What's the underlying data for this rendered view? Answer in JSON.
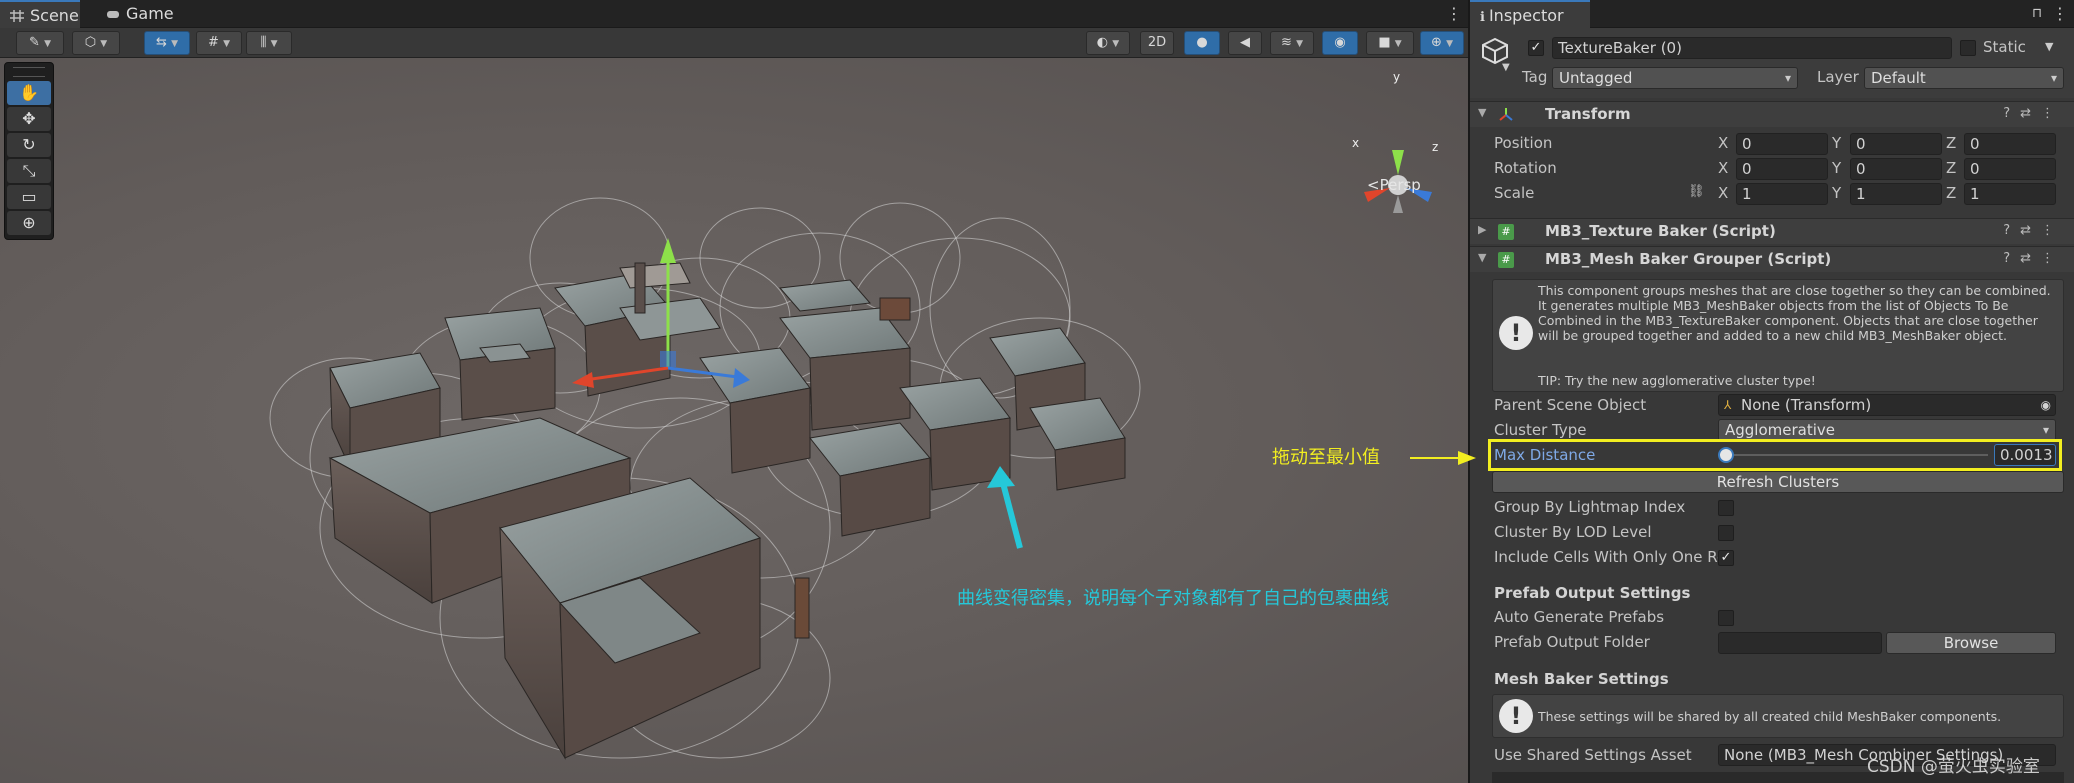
{
  "scene_tabs": [
    {
      "label": "Scene",
      "icon": "grid-icon",
      "active": true
    },
    {
      "label": "Game",
      "icon": "gamepad-icon",
      "active": false
    }
  ],
  "scene_toolbar": {
    "mode_2d_label": "2D"
  },
  "viewport": {
    "persp_label": "Persp",
    "gizmo_axes": {
      "x": "x",
      "y": "y",
      "z": "z"
    }
  },
  "annotations": {
    "curves_note": "曲线变得密集，说明每个子对象都有了自己的包裹曲线",
    "drag_note": "拖动至最小值"
  },
  "inspector": {
    "tab_label": "Inspector",
    "object_name": "TextureBaker (0)",
    "active_checked": true,
    "static_label": "Static",
    "tag_label": "Tag",
    "tag_value": "Untagged",
    "layer_label": "Layer",
    "layer_value": "Default",
    "transform": {
      "title": "Transform",
      "position": {
        "label": "Position",
        "x": "0",
        "y": "0",
        "z": "0"
      },
      "rotation": {
        "label": "Rotation",
        "x": "0",
        "y": "0",
        "z": "0"
      },
      "scale": {
        "label": "Scale",
        "x": "1",
        "y": "1",
        "z": "1"
      },
      "axis_labels": {
        "x": "X",
        "y": "Y",
        "z": "Z"
      }
    },
    "texture_baker": {
      "title": "MB3_Texture Baker (Script)"
    },
    "mesh_baker_grouper": {
      "title": "MB3_Mesh Baker Grouper (Script)",
      "help_text": "This component groups meshes that are close together so they can be combined. It generates multiple MB3_MeshBaker objects from the list of Objects To Be Combined in the MB3_TextureBaker component. Objects that are close together will be grouped together and added to a new child MB3_MeshBaker object.",
      "tip_text": "TIP: Try the new agglomerative cluster type!",
      "parent_scene_object": {
        "label": "Parent Scene Object",
        "value": "None (Transform)"
      },
      "cluster_type": {
        "label": "Cluster Type",
        "value": "Agglomerative"
      },
      "max_distance": {
        "label": "Max Distance",
        "value": "0.0013",
        "slider_fraction": 0.0
      },
      "refresh_button": "Refresh Clusters",
      "group_by_lightmap": {
        "label": "Group By Lightmap Index",
        "checked": false
      },
      "cluster_by_lod": {
        "label": "Cluster By LOD Level",
        "checked": false
      },
      "include_cells": {
        "label": "Include Cells With Only One Re",
        "checked": true
      },
      "prefab_output_title": "Prefab Output Settings",
      "auto_generate_prefabs": {
        "label": "Auto Generate Prefabs",
        "checked": false
      },
      "prefab_output_folder": {
        "label": "Prefab Output Folder",
        "value": ""
      },
      "browse_button": "Browse",
      "mesh_baker_settings_title": "Mesh Baker Settings",
      "mesh_baker_help": "These settings will be shared by all created child MeshBaker components.",
      "shared_settings": {
        "label": "Use Shared Settings Asset",
        "value": "None (MB3_Mesh Combiner Settings)"
      }
    }
  },
  "watermark": "CSDN @萤火虫实验室",
  "colors": {
    "accent_blue": "#3a79bb",
    "highlight_yellow": "#f2ee20",
    "annotation_cyan": "#25c8d9"
  }
}
